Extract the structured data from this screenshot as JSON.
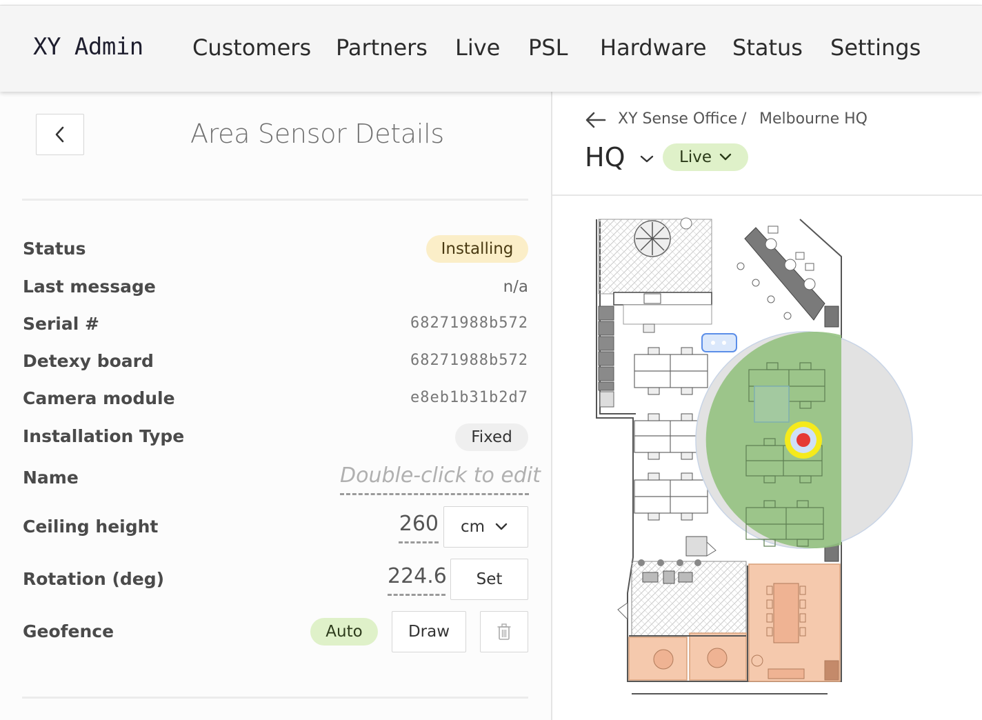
{
  "navbar": {
    "brand": "XY Admin",
    "items": [
      "Customers",
      "Partners",
      "Live",
      "PSL",
      "Hardware",
      "Status",
      "Settings"
    ]
  },
  "panel": {
    "title": "Area Sensor Details",
    "rows": {
      "status": {
        "label": "Status",
        "value": "Installing"
      },
      "last_message": {
        "label": "Last message",
        "value": "n/a"
      },
      "serial": {
        "label": "Serial #",
        "value": "68271988b572"
      },
      "detexy_board": {
        "label": "Detexy board",
        "value": "68271988b572"
      },
      "camera_module": {
        "label": "Camera module",
        "value": "e8eb1b31b2d7"
      },
      "installation_type": {
        "label": "Installation Type",
        "value": "Fixed"
      },
      "name": {
        "label": "Name",
        "placeholder": "Double-click to edit"
      },
      "ceiling_height": {
        "label": "Ceiling height",
        "value": "260",
        "unit": "cm"
      },
      "rotation": {
        "label": "Rotation (deg)",
        "value": "224.6",
        "button": "Set"
      },
      "geofence": {
        "label": "Geofence",
        "auto": "Auto",
        "draw": "Draw"
      }
    }
  },
  "floor": {
    "breadcrumb": [
      "XY Sense Office",
      "Melbourne HQ"
    ],
    "separator": "/",
    "floor_name": "HQ",
    "mode": "Live"
  },
  "colors": {
    "status_installing_bg": "#fbeec8",
    "live_bg": "#dff1c9",
    "sensor_coverage": "#7fb36a",
    "sensor_marker": "#e53935",
    "sensor_ring": "#f5ea1c",
    "meeting_room": "#f5c9ad"
  },
  "icons": {
    "back": "chevron-left-icon",
    "breadcrumb_back": "arrow-left-icon",
    "dropdown": "chevron-down-icon",
    "delete": "trash-icon"
  }
}
